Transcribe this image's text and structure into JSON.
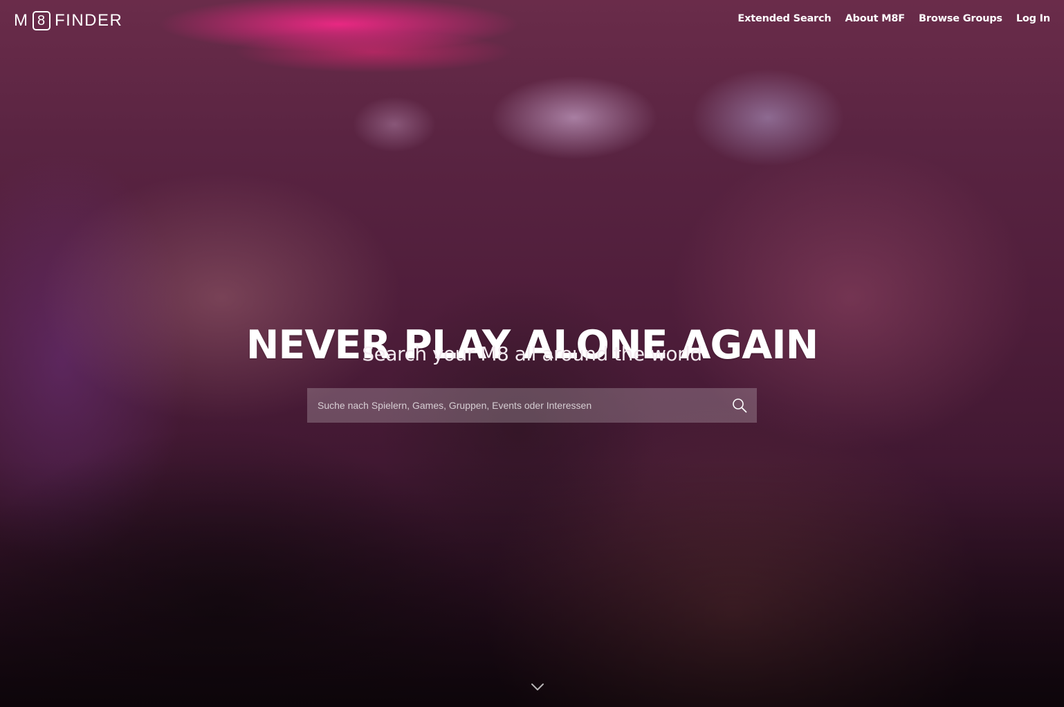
{
  "brand": {
    "prefix": "M",
    "badge": "8",
    "suffix": "FINDER"
  },
  "nav": {
    "items": [
      {
        "label": "Extended Search"
      },
      {
        "label": "About M8F"
      },
      {
        "label": "Browse Groups"
      },
      {
        "label": "Log In"
      }
    ]
  },
  "hero": {
    "headline": "NEVER PLAY ALONE AGAIN",
    "subline": "Search your M8 all around the world",
    "background": "blurred photo of a crowded party / concert in magenta-purple lighting"
  },
  "search": {
    "placeholder": "Suche nach Spielern, Games, Gruppen, Events oder Interessen",
    "value": "",
    "icon": "search-icon"
  },
  "scroll": {
    "icon": "chevron-down-icon"
  },
  "colors": {
    "text": "#ffffff",
    "overlay": "#5a2442",
    "search_bg": "rgba(255,255,255,0.22)"
  }
}
